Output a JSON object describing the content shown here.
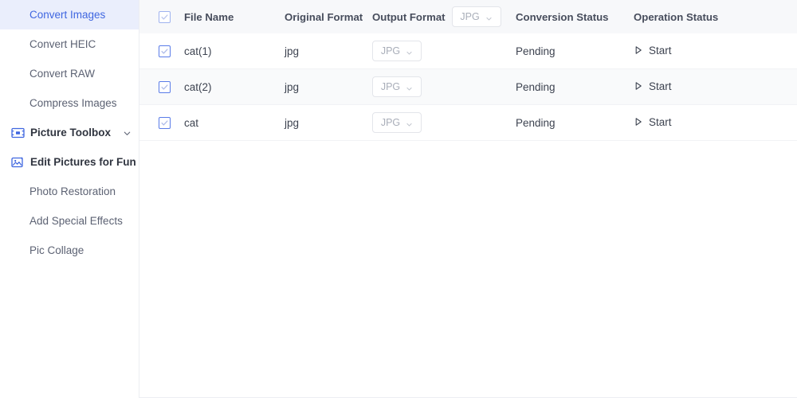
{
  "sidebar": {
    "items": [
      {
        "label": "Convert Images",
        "type": "sub",
        "active": true
      },
      {
        "label": "Convert HEIC",
        "type": "sub",
        "active": false
      },
      {
        "label": "Convert RAW",
        "type": "sub",
        "active": false
      },
      {
        "label": "Compress Images",
        "type": "sub",
        "active": false
      },
      {
        "label": "Picture Toolbox",
        "type": "group",
        "icon": "picture-toolbox-icon",
        "chevron": "chevron-down"
      },
      {
        "label": "Edit Pictures for Fun",
        "type": "group",
        "icon": "edit-pictures-icon",
        "chevron": "chevron-up"
      },
      {
        "label": "Photo Restoration",
        "type": "sub",
        "active": false
      },
      {
        "label": "Add Special Effects",
        "type": "sub",
        "active": false
      },
      {
        "label": "Pic Collage",
        "type": "sub",
        "active": false
      }
    ]
  },
  "table": {
    "columns": {
      "file_name": "File Name",
      "original_format": "Original Format",
      "output_format": "Output Format",
      "conversion_status": "Conversion Status",
      "operation_status": "Operation Status"
    },
    "header_output_format_value": "JPG",
    "rows": [
      {
        "file_name": "cat(1)",
        "original_format": "jpg",
        "output_format": "JPG",
        "conversion_status": "Pending",
        "operation_label": "Start",
        "checked": true
      },
      {
        "file_name": "cat(2)",
        "original_format": "jpg",
        "output_format": "JPG",
        "conversion_status": "Pending",
        "operation_label": "Start",
        "checked": true
      },
      {
        "file_name": "cat",
        "original_format": "jpg",
        "output_format": "JPG",
        "conversion_status": "Pending",
        "operation_label": "Start",
        "checked": true
      }
    ],
    "select_all_checked": true
  },
  "colors": {
    "accent": "#3f66e0",
    "active_bg": "#eaeefc",
    "header_bg": "#f7f8fa",
    "row_alt_bg": "#f9fafb",
    "border": "#eceef2",
    "checkbox_border": "#5a7ce8",
    "muted_text": "#a9aeb9"
  }
}
